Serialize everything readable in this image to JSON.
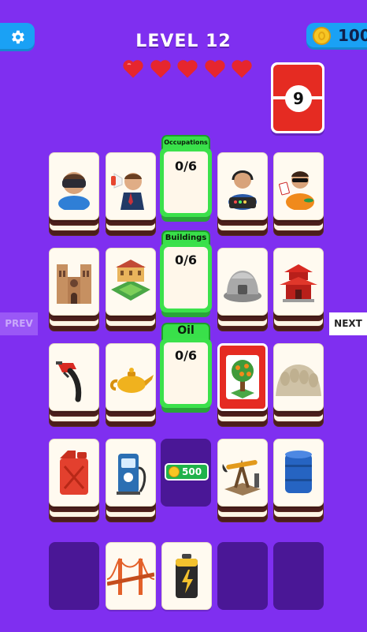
{
  "header": {
    "level_title": "LEVEL 12",
    "coins": "100",
    "hearts": 5,
    "remaining_cards": "9",
    "settings_icon": "gear-icon",
    "coin_icon": "coin-icon"
  },
  "categories": [
    {
      "name": "Occupations",
      "count": "0/6"
    },
    {
      "name": "Buildings",
      "count": "0/6"
    },
    {
      "name": "Oil",
      "count": "0/6"
    }
  ],
  "tiles": {
    "row1": [
      "vr-headset-person",
      "megaphone-businessman",
      "call-center-operator",
      "poker-player"
    ],
    "row2": [
      "notre-dame-cathedral",
      "palace-with-gardens",
      "stone-house",
      "chinese-temple"
    ],
    "row3": [
      "fuel-nozzle",
      "oil-lamp",
      "orange-tree-card",
      "mount-rushmore"
    ],
    "row4": [
      "jerry-can",
      "charging-station",
      "oil-pump-jack",
      "oil-barrel"
    ],
    "row5": [
      "golden-gate-bridge",
      "battery"
    ]
  },
  "reward": {
    "value": "500"
  },
  "nav": {
    "prev": "PREV",
    "next": "NEXT"
  },
  "colors": {
    "background": "#7f2ff0",
    "slot_green": "#3be14b",
    "accent_blue": "#1aa1f5",
    "heart_red": "#e6262e"
  }
}
